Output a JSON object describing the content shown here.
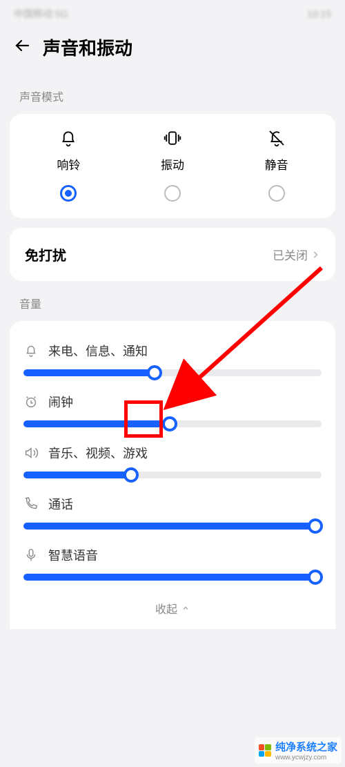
{
  "status": {
    "left": "中国移动  5G",
    "right": "10:15"
  },
  "header": {
    "title": "声音和振动"
  },
  "sound_mode": {
    "section_label": "声音模式",
    "options": [
      {
        "label": "响铃",
        "icon": "bell",
        "selected": true
      },
      {
        "label": "振动",
        "icon": "vibrate",
        "selected": false
      },
      {
        "label": "静音",
        "icon": "bell-off",
        "selected": false
      }
    ]
  },
  "dnd": {
    "title": "免打扰",
    "status": "已关闭"
  },
  "volume": {
    "section_label": "音量",
    "sliders": [
      {
        "icon": "bell",
        "label": "来电、信息、通知",
        "percent": 44
      },
      {
        "icon": "clock",
        "label": "闹钟",
        "percent": 49
      },
      {
        "icon": "speaker",
        "label": "音乐、视频、游戏",
        "percent": 36
      },
      {
        "icon": "phone",
        "label": "通话",
        "percent": 100
      },
      {
        "icon": "mic",
        "label": "智慧语音",
        "percent": 100
      }
    ],
    "collapse_label": "收起"
  },
  "watermark": {
    "text": "纯净系统之家",
    "url": "www.ycwjzy.com"
  }
}
